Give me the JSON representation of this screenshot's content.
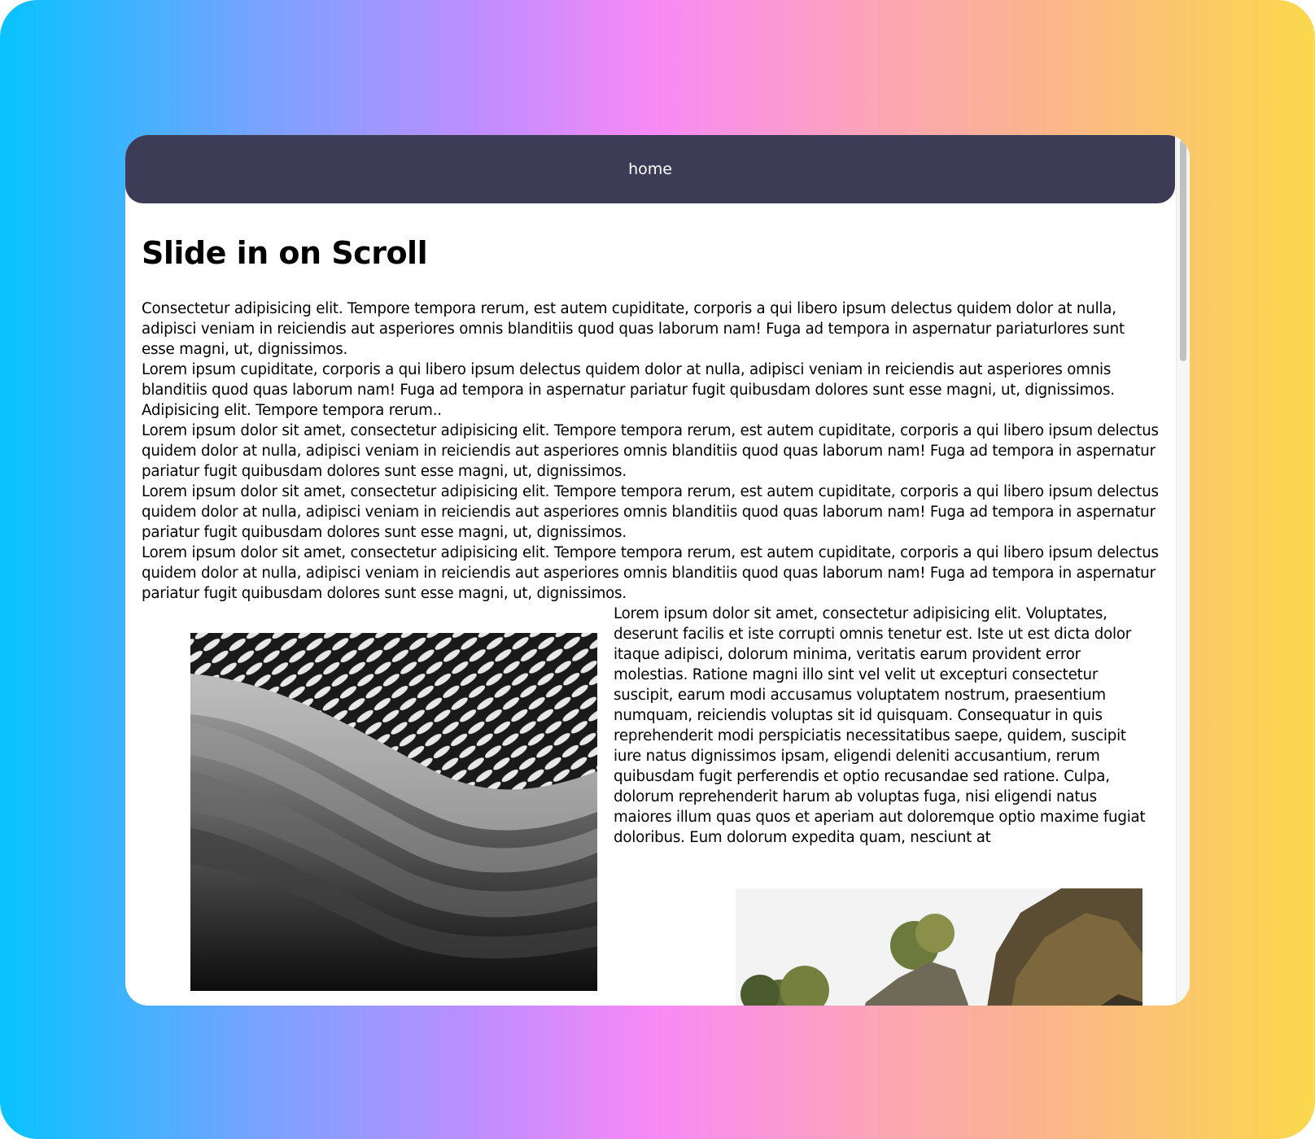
{
  "nav": {
    "home_label": "home"
  },
  "page": {
    "title": "Slide in on Scroll",
    "paragraphs": [
      "Consectetur adipisicing elit. Tempore tempora rerum, est autem cupiditate, corporis a qui libero ipsum delectus quidem dolor at nulla, adipisci veniam in reiciendis aut asperiores omnis blanditiis quod quas laborum nam! Fuga ad tempora in aspernatur pariaturlores sunt esse magni, ut, dignissimos.",
      "Lorem ipsum cupiditate, corporis a qui libero ipsum delectus quidem dolor at nulla, adipisci veniam in reiciendis aut asperiores omnis blanditiis quod quas laborum nam! Fuga ad tempora in aspernatur pariatur fugit quibusdam dolores sunt esse magni, ut, dignissimos.",
      "Adipisicing elit. Tempore tempora rerum..",
      "Lorem ipsum dolor sit amet, consectetur adipisicing elit. Tempore tempora rerum, est autem cupiditate, corporis a qui libero ipsum delectus quidem dolor at nulla, adipisci veniam in reiciendis aut asperiores omnis blanditiis quod quas laborum nam! Fuga ad tempora in aspernatur pariatur fugit quibusdam dolores sunt esse magni, ut, dignissimos.",
      "Lorem ipsum dolor sit amet, consectetur adipisicing elit. Tempore tempora rerum, est autem cupiditate, corporis a qui libero ipsum delectus quidem dolor at nulla, adipisci veniam in reiciendis aut asperiores omnis blanditiis quod quas laborum nam! Fuga ad tempora in aspernatur pariatur fugit quibusdam dolores sunt esse magni, ut, dignissimos.",
      "Lorem ipsum dolor sit amet, consectetur adipisicing elit. Tempore tempora rerum, est autem cupiditate, corporis a qui libero ipsum delectus quidem dolor at nulla, adipisci veniam in reiciendis aut asperiores omnis blanditiis quod quas laborum nam! Fuga ad tempora in aspernatur pariatur fugit quibusdam dolores sunt esse magni, ut, dignissimos."
    ],
    "side_text": "Lorem ipsum dolor sit amet, consectetur adipisicing elit. Voluptates, deserunt facilis et iste corrupti omnis tenetur est. Iste ut est dicta dolor itaque adipisci, dolorum minima, veritatis earum provident error molestias. Ratione magni illo sint vel velit ut excepturi consectetur suscipit, earum modi accusamus voluptatem nostrum, praesentium numquam, reiciendis voluptas sit id quisquam. Consequatur in quis reprehenderit modi perspiciatis necessitatibus saepe, quidem, suscipit iure natus dignissimos ipsam, eligendi deleniti accusantium, rerum quibusdam fugit perferendis et optio recusandae sed ratione. Culpa, dolorum reprehenderit harum ab voluptas fuga, nisi eligendi natus maiores illum quas quos et aperiam aut doloremque optio maxime fugiat doloribus. Eum dolorum expedita quam, nesciunt at"
  },
  "colors": {
    "navbar_bg": "#3d3c57",
    "page_bg": "#ffffff",
    "backdrop_gradient": [
      "#08c2ff",
      "#f98af5",
      "#fbd84c"
    ]
  },
  "images": {
    "left": "architecture-photo",
    "right": "rocks-trees-photo"
  }
}
